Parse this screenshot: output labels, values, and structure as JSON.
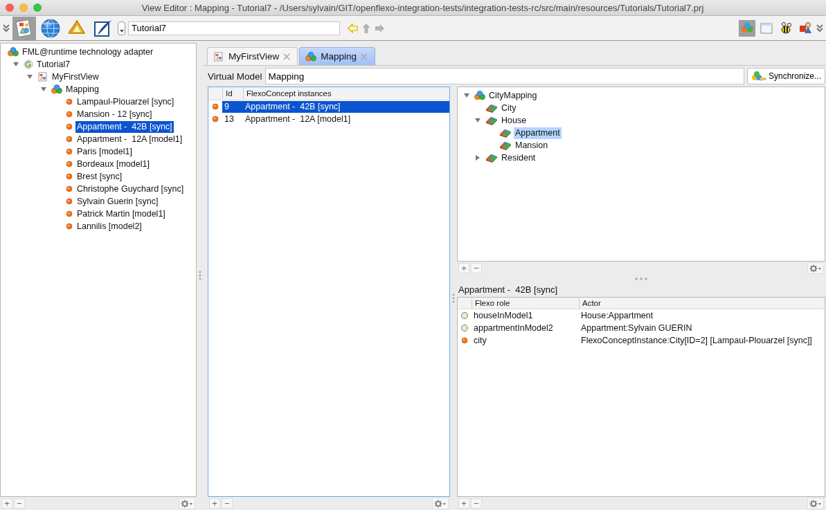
{
  "window": {
    "title": "View Editor : Mapping - Tutorial7 - /Users/sylvain/GIT/openflexo-integration-tests/integration-tests-rc/src/main/resources/Tutorials/Tutorial7.prj"
  },
  "toolbar": {
    "perspectives": [
      {
        "kind": "diagram",
        "selected": true
      },
      {
        "kind": "globe",
        "selected": false
      },
      {
        "kind": "tools",
        "selected": false
      },
      {
        "kind": "writer",
        "selected": false
      }
    ],
    "path_field": {
      "value": "Tutorial7"
    },
    "navigation": [
      {
        "kind": "back",
        "disabled": false
      },
      {
        "kind": "up",
        "disabled": true
      },
      {
        "kind": "forward",
        "disabled": true
      }
    ],
    "tools": [
      {
        "kind": "cubes",
        "selected": true
      },
      {
        "kind": "window",
        "selected": false
      },
      {
        "kind": "bee",
        "selected": false
      },
      {
        "kind": "shapes",
        "selected": false
      }
    ]
  },
  "browser": {
    "tree": [
      {
        "label": "FML@runtime technology adapter",
        "kind": "cluster",
        "selected": false,
        "children": [
          {
            "label": "Tutorial7",
            "kind": "project",
            "expanded": true,
            "selected": false,
            "children": [
              {
                "label": "MyFirstView",
                "kind": "view",
                "expanded": true,
                "selected": false,
                "children": [
                  {
                    "label": "Mapping",
                    "kind": "cluster",
                    "expanded": true,
                    "selected": false,
                    "children": [
                      {
                        "label": "Lampaul-Plouarzel [sync]",
                        "kind": "instance",
                        "selected": false
                      },
                      {
                        "label": "Mansion - 12 [sync]",
                        "kind": "instance",
                        "selected": false
                      },
                      {
                        "label": "Appartment -  42B [sync]",
                        "kind": "instance",
                        "selected": true
                      },
                      {
                        "label": "Appartment -  12A [model1]",
                        "kind": "instance",
                        "selected": false
                      },
                      {
                        "label": "Paris [model1]",
                        "kind": "instance",
                        "selected": false
                      },
                      {
                        "label": "Bordeaux [model1]",
                        "kind": "instance",
                        "selected": false
                      },
                      {
                        "label": "Brest [sync]",
                        "kind": "instance",
                        "selected": false
                      },
                      {
                        "label": "Christophe Guychard [sync]",
                        "kind": "instance",
                        "selected": false
                      },
                      {
                        "label": "Sylvain Guerin [sync]",
                        "kind": "instance",
                        "selected": false
                      },
                      {
                        "label": "Patrick Martin [model1]",
                        "kind": "instance",
                        "selected": false
                      },
                      {
                        "label": "Lannilis [model2]",
                        "kind": "instance",
                        "selected": false
                      }
                    ]
                  }
                ]
              }
            ]
          }
        ]
      }
    ],
    "footer": {
      "buttons": [
        "+",
        "−"
      ]
    }
  },
  "tabs": [
    {
      "label": "MyFirstView",
      "kind": "view",
      "selected": false
    },
    {
      "label": "Mapping",
      "kind": "cluster",
      "selected": true
    }
  ],
  "virtual_model": {
    "label": "Virtual Model",
    "value": "Mapping",
    "button": "Synchronize..."
  },
  "instances_table": {
    "columns": [
      "Id",
      "FlexoConcept instances"
    ],
    "rows": [
      {
        "id": "9",
        "name": "Appartment -  42B [sync]",
        "selected": true
      },
      {
        "id": "13",
        "name": "Appartment -  12A [model1]",
        "selected": false
      }
    ],
    "footer": {
      "buttons": [
        "+",
        "−"
      ]
    }
  },
  "concept_tree": {
    "tree": [
      {
        "label": "CityMapping",
        "kind": "cluster",
        "expanded": true,
        "selected": false,
        "children": [
          {
            "label": "City",
            "kind": "concept",
            "selected": false
          },
          {
            "label": "House",
            "kind": "concept",
            "expanded": true,
            "selected": false,
            "children": [
              {
                "label": "Appartment",
                "kind": "concept",
                "selected": true
              },
              {
                "label": "Mansion",
                "kind": "concept",
                "selected": false
              }
            ]
          },
          {
            "label": "Resident",
            "kind": "concept",
            "expanded": false,
            "selected": false
          }
        ]
      }
    ],
    "footer": {
      "buttons": [
        "+",
        "−"
      ]
    }
  },
  "details": {
    "title": "Appartment -  42B [sync]",
    "columns": [
      "Flexo role",
      "Actor"
    ],
    "rows": [
      {
        "kind": "model",
        "role": "houseInModel1",
        "actor": "House:Appartment"
      },
      {
        "kind": "model",
        "role": "appartmentInModel2",
        "actor": "Appartment:Sylvain GUERIN"
      },
      {
        "kind": "instance",
        "role": "city",
        "actor": "FlexoConceptInstance:City[ID=2] [Lampaul-Plouarzel [sync]]"
      }
    ],
    "footer": {
      "buttons": [
        "+",
        "−"
      ]
    }
  }
}
